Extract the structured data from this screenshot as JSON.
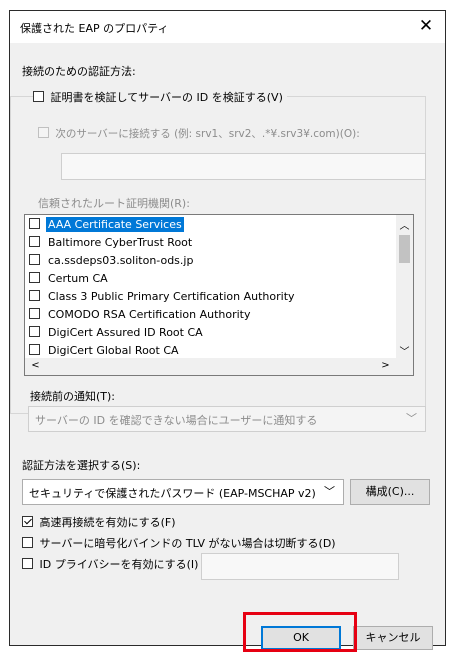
{
  "window": {
    "title": "保護された EAP のプロパティ",
    "close_glyph": "✕"
  },
  "auth_heading": "接続のための認証方法:",
  "verify_cert": {
    "label": "証明書を検証してサーバーの ID を検証する(V)",
    "checked": false
  },
  "connect_servers": {
    "label": "次のサーバーに接続する (例: srv1、srv2、.*¥.srv3¥.com)(O):",
    "checked": false,
    "value": ""
  },
  "trusted_root_label": "信頼されたルート証明機関(R):",
  "root_cas": [
    {
      "name": "AAA Certificate Services",
      "selected": true
    },
    {
      "name": "Baltimore CyberTrust Root",
      "selected": false
    },
    {
      "name": "ca.ssdeps03.soliton-ods.jp",
      "selected": false
    },
    {
      "name": "Certum CA",
      "selected": false
    },
    {
      "name": "Class 3 Public Primary Certification Authority",
      "selected": false
    },
    {
      "name": "COMODO RSA Certification Authority",
      "selected": false
    },
    {
      "name": "DigiCert Assured ID Root CA",
      "selected": false
    },
    {
      "name": "DigiCert Global Root CA",
      "selected": false
    }
  ],
  "notify": {
    "label": "接続前の通知(T):",
    "value": "サーバーの ID を確認できない場合にユーザーに通知する"
  },
  "method": {
    "label": "認証方法を選択する(S):",
    "value": "セキュリティで保護されたパスワード (EAP-MSCHAP v2)",
    "configure_label": "構成(C)..."
  },
  "options": {
    "fast_reconnect": {
      "label": "高速再接続を有効にする(F)",
      "checked": true
    },
    "disconnect_tlv": {
      "label": "サーバーに暗号化バインドの TLV がない場合は切断する(D)",
      "checked": false
    },
    "identity_privacy": {
      "label": "ID プライバシーを有効にする(I)",
      "checked": false,
      "value": ""
    }
  },
  "buttons": {
    "ok": "OK",
    "cancel": "キャンセル"
  },
  "colors": {
    "highlight": "#e60012",
    "selection": "#0078d7"
  }
}
